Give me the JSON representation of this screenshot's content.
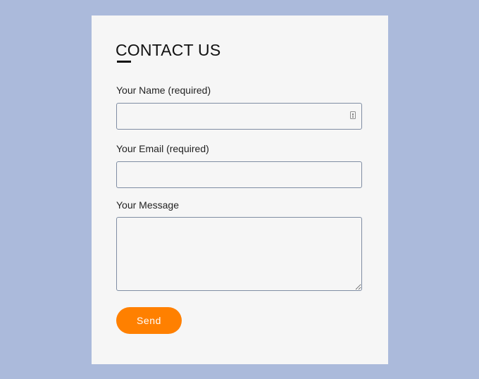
{
  "contact_form": {
    "title": "CONTACT US",
    "name_label": "Your Name (required)",
    "name_value": "",
    "email_label": "Your Email (required)",
    "email_value": "",
    "message_label": "Your Message",
    "message_value": "",
    "send_label": "Send",
    "icons": {
      "name_field_icon": "autofill-card-icon"
    },
    "colors": {
      "page_background": "#abbadb",
      "card_background": "#f6f6f6",
      "accent": "#ff8000",
      "field_border": "#7f8da3"
    }
  }
}
